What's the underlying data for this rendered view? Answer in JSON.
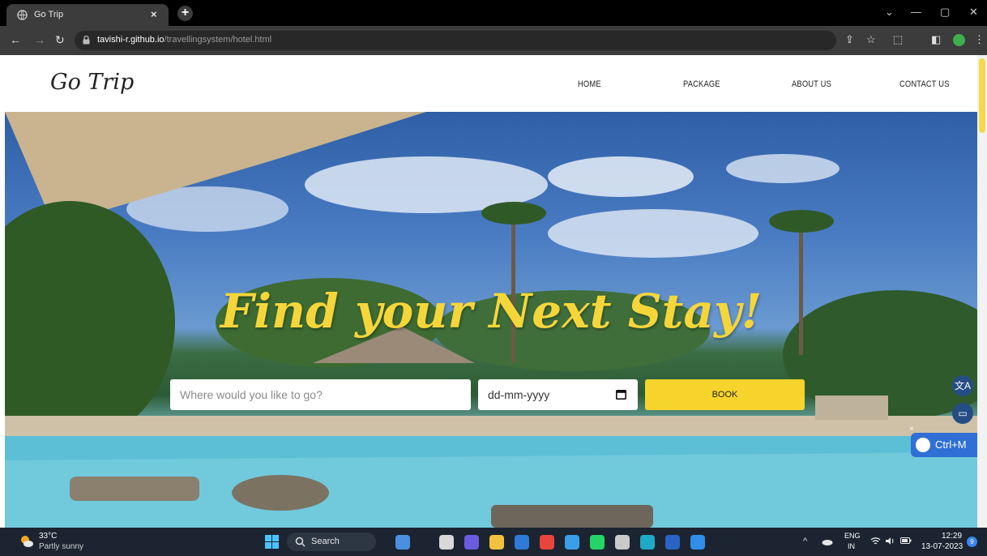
{
  "browser": {
    "tab_title": "Go Trip",
    "tab_close": "×",
    "new_tab": "+",
    "url_host": "tavishi-r.github.io",
    "url_path": "/travellingsystem/hotel.html",
    "window_controls": {
      "chevron": "⌄",
      "minimize": "—",
      "restore": "▢",
      "close": "✕"
    },
    "toolbar_glyphs": {
      "back": "←",
      "forward": "→",
      "reload": "↻",
      "share": "⇪",
      "star": "☆",
      "extensions": "⬚",
      "sidepanel": "◧",
      "menu": "⋮"
    }
  },
  "site": {
    "logo": "Go Trip",
    "nav": [
      "HOME",
      "PACKAGE",
      "ABOUT US",
      "CONTACT US"
    ],
    "hero_heading": "Find your Next Stay!",
    "search": {
      "placeholder": "Where would you like to go?",
      "date_placeholder": "dd-mm-yyyy",
      "book_label": "BOOK"
    },
    "side_buttons": {
      "translate": "文A",
      "reader": "▭"
    },
    "extension_shortcut": "Ctrl+M",
    "extension_close": "×"
  },
  "taskbar": {
    "weather_temp": "33°C",
    "weather_desc": "Partly sunny",
    "search_label": "Search",
    "apps": [
      {
        "name": "widgets-app",
        "color": "#4a8fe0"
      },
      {
        "name": "task-view-app",
        "color": "#d8d8d8"
      },
      {
        "name": "meet-app",
        "color": "#6a5be0"
      },
      {
        "name": "file-explorer-app",
        "color": "#f2c13d"
      },
      {
        "name": "mail-app",
        "color": "#2e7ad6"
      },
      {
        "name": "chrome-app",
        "color": "#e8453c"
      },
      {
        "name": "photos-app",
        "color": "#3a9ee8"
      },
      {
        "name": "whatsapp-app",
        "color": "#25d366"
      },
      {
        "name": "3d-app",
        "color": "#c9c9c9"
      },
      {
        "name": "edge-app",
        "color": "#1fa9c9"
      },
      {
        "name": "word-app",
        "color": "#2b63c4"
      },
      {
        "name": "vscode-app",
        "color": "#2f8fe8"
      }
    ],
    "tray_up": "^",
    "lang_1": "ENG",
    "lang_2": "IN",
    "time": "12:29",
    "date": "13-07-2023",
    "notifications": "9"
  },
  "colors": {
    "accent_yellow": "#f6d42c",
    "brand_blue": "#2f6fd6"
  }
}
